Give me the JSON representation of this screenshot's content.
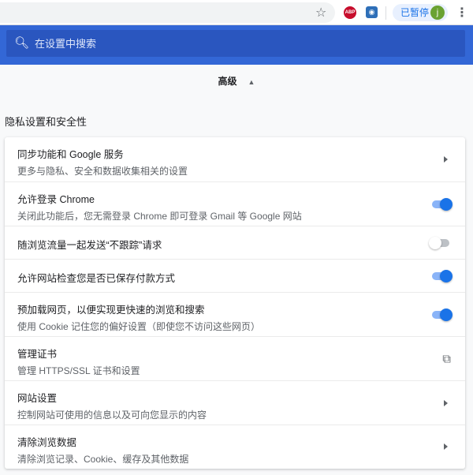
{
  "toolbar": {
    "paused_label": "已暂停",
    "avatar_letter": "j",
    "abp_label": "ABP"
  },
  "search": {
    "placeholder": "在设置中搜索"
  },
  "advanced": {
    "label": "高级"
  },
  "section": {
    "title": "隐私设置和安全性"
  },
  "rows": [
    {
      "title": "同步功能和 Google 服务",
      "subtitle": "更多与隐私、安全和数据收集相关的设置",
      "control": "arrow"
    },
    {
      "title": "允许登录 Chrome",
      "subtitle": "关闭此功能后，您无需登录 Chrome 即可登录 Gmail 等 Google 网站",
      "control": "toggle",
      "on": true
    },
    {
      "title": "随浏览流量一起发送“不跟踪”请求",
      "control": "toggle",
      "on": false
    },
    {
      "title": "允许网站检查您是否已保存付款方式",
      "control": "toggle",
      "on": true
    },
    {
      "title": "预加载网页，以便实现更快速的浏览和搜索",
      "subtitle": "使用 Cookie 记住您的偏好设置（即使您不访问这些网页）",
      "control": "toggle",
      "on": true
    },
    {
      "title": "管理证书",
      "subtitle": "管理 HTTPS/SSL 证书和设置",
      "control": "external"
    },
    {
      "title": "网站设置",
      "subtitle": "控制网站可使用的信息以及可向您显示的内容",
      "control": "arrow"
    },
    {
      "title": "清除浏览数据",
      "subtitle": "清除浏览记录、Cookie、缓存及其他数据",
      "control": "arrow"
    }
  ]
}
